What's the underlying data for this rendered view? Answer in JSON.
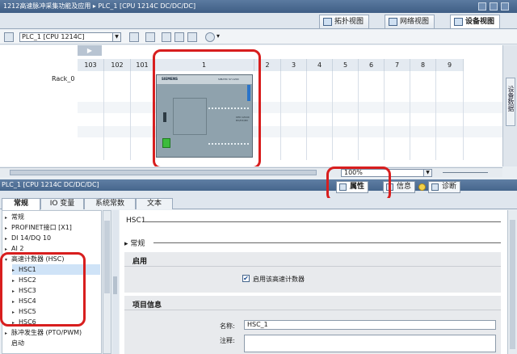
{
  "window": {
    "title": "1212高速脉冲采集功能及应用 ▸ PLC_1 [CPU 1214C DC/DC/DC]"
  },
  "view_tabs": [
    {
      "label": "拓扑视图",
      "icon": "topology-icon"
    },
    {
      "label": "网络视图",
      "icon": "network-icon"
    },
    {
      "label": "设备视图",
      "icon": "device-icon",
      "active": true
    }
  ],
  "device_toolbar": {
    "device_select": "PLC_1 [CPU 1214C]"
  },
  "rack": {
    "label": "Rack_0",
    "slots": [
      "103",
      "102",
      "101",
      "1",
      "2",
      "3",
      "4",
      "5",
      "6",
      "7",
      "8",
      "9"
    ],
    "cpu": {
      "brand": "SIEMENS",
      "model": "SIMATIC S7-1200",
      "info": "CPU 1214C DC/DC/DC"
    },
    "zoom": "100%",
    "side_tab": "设备数据"
  },
  "inspector": {
    "title": "PLC_1 [CPU 1214C DC/DC/DC]",
    "panel_tabs": [
      {
        "label": "属性",
        "active": true
      },
      {
        "label": "信息"
      },
      {
        "label": "诊断"
      }
    ],
    "sub_tabs": [
      "常规",
      "IO 变量",
      "系统常数",
      "文本"
    ],
    "tree": [
      {
        "label": "常规",
        "level": 0,
        "arrow": "▸"
      },
      {
        "label": "PROFINET接口 [X1]",
        "level": 0,
        "arrow": "▸"
      },
      {
        "label": "DI 14/DQ 10",
        "level": 0,
        "arrow": "▸"
      },
      {
        "label": "AI 2",
        "level": 0,
        "arrow": "▸"
      },
      {
        "label": "高速计数器 (HSC)",
        "level": 0,
        "arrow": "▾"
      },
      {
        "label": "HSC1",
        "level": 1,
        "arrow": "▸",
        "selected": true
      },
      {
        "label": "HSC2",
        "level": 1,
        "arrow": "▸"
      },
      {
        "label": "HSC3",
        "level": 1,
        "arrow": "▸"
      },
      {
        "label": "HSC4",
        "level": 1,
        "arrow": "▸"
      },
      {
        "label": "HSC5",
        "level": 1,
        "arrow": "▸"
      },
      {
        "label": "HSC6",
        "level": 1,
        "arrow": "▸"
      },
      {
        "label": "脉冲发生器 (PTO/PWM)",
        "level": 0,
        "arrow": "▸"
      },
      {
        "label": "启动",
        "level": 0,
        "arrow": ""
      }
    ],
    "props": {
      "heading": "HSC1",
      "general": "常规",
      "enable_section": "启用",
      "enable_checkbox_label": "启用该高速计数器",
      "enable_checked": true,
      "project_section": "项目信息",
      "name_label": "名称:",
      "name_value": "HSC_1",
      "comment_label": "注释:",
      "comment_value": ""
    }
  },
  "colors": {
    "highlight": "#d81e1e",
    "title_bar": "#45658c",
    "cpu_body": "#8fa2ad",
    "cpu_run_led": "#3cbb3c"
  }
}
